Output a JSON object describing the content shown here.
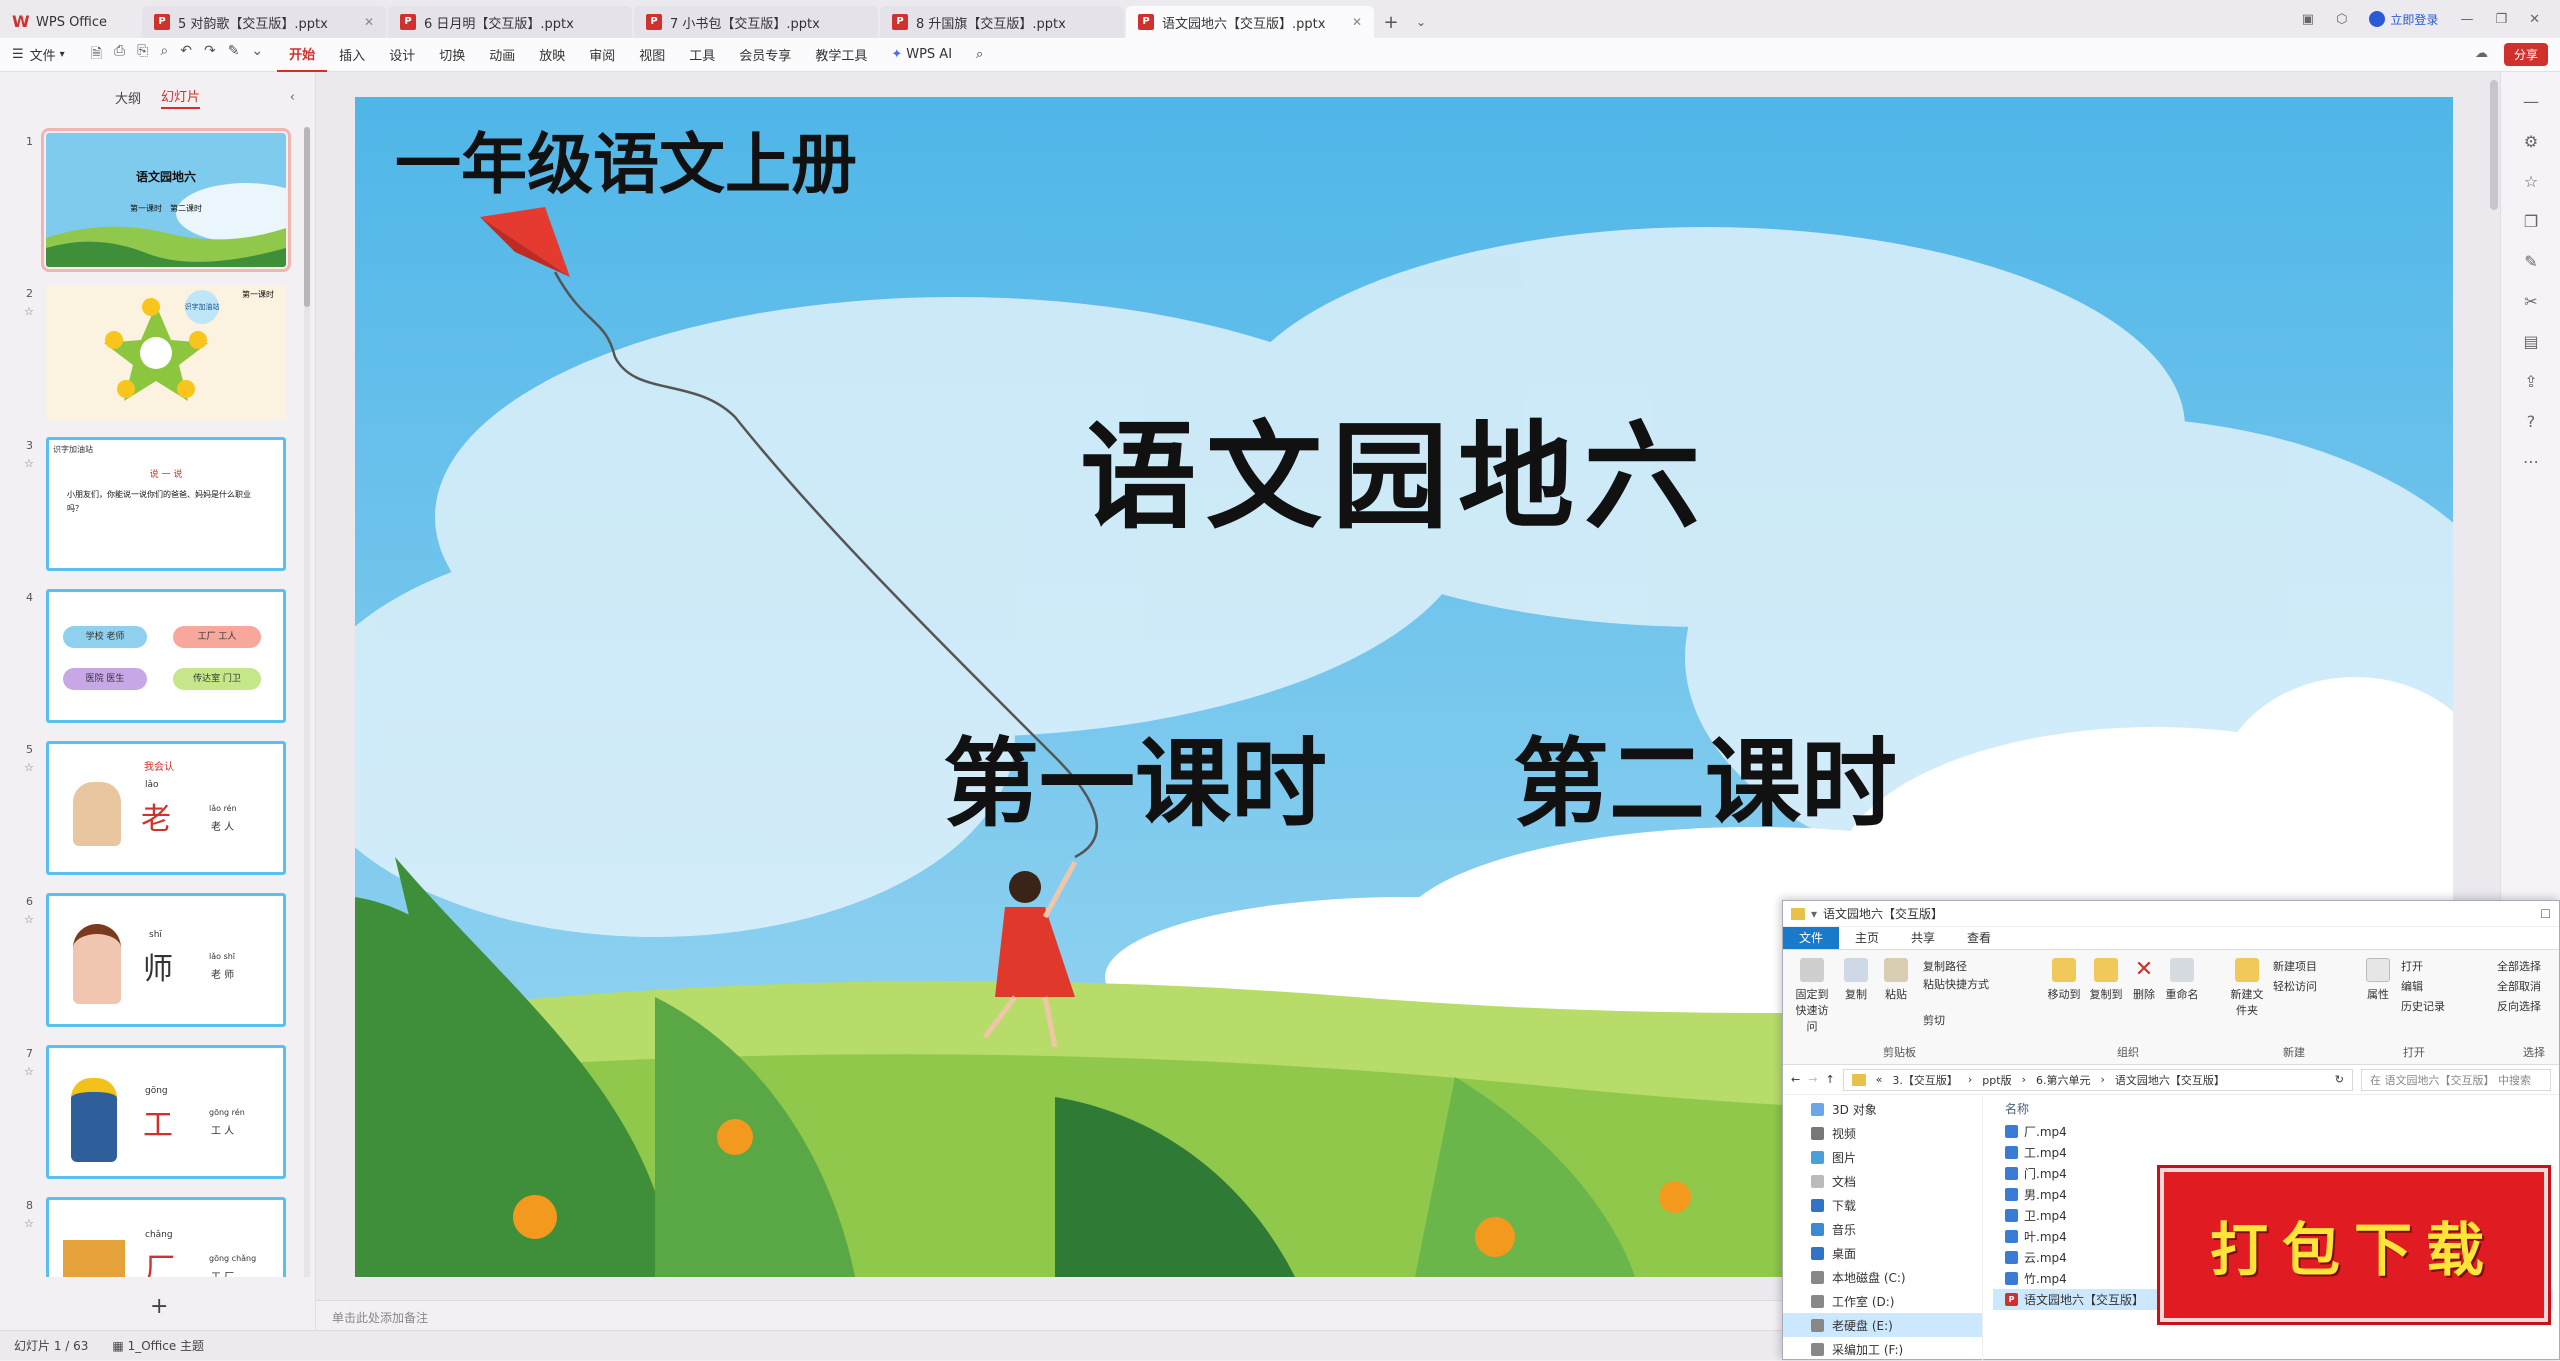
{
  "tabs": {
    "home": "WPS Office",
    "docs": [
      "5 对韵歌【交互版】.pptx",
      "6 日月明【交互版】.pptx",
      "7 小书包【交互版】.pptx",
      "8 升国旗【交互版】.pptx"
    ],
    "active": "语文园地六【交互版】.pptx",
    "login": "立即登录"
  },
  "ribbon": {
    "file": "文件",
    "menus": [
      "开始",
      "插入",
      "设计",
      "切换",
      "动画",
      "放映",
      "审阅",
      "视图",
      "工具",
      "会员专享",
      "教学工具"
    ],
    "ai": "WPS AI",
    "share": "分享"
  },
  "panel": {
    "outline": "大纲",
    "slides": "幻灯片"
  },
  "thumbs": {
    "t1_title": "语文园地六",
    "t1_sub": "第一课时　第二课时",
    "t2_label": "第一课时",
    "t2_badge": "识字加油站",
    "t3_tag": "识字加油站",
    "t3_head": "说 一 说",
    "t3_text": "小朋友们，你能说一说你们的爸爸、妈妈是什么职业吗？",
    "t4_words": [
      "学校 老师",
      "工厂 工人",
      "医院 医生",
      "传达室 门卫"
    ],
    "t5_head": "我会认",
    "slides": [
      {
        "py": "lǎo",
        "char": "老",
        "word_py": "lǎo rén",
        "word": "老 人"
      },
      {
        "py": "shī",
        "char": "师",
        "word_py": "lǎo shī",
        "word": "老 师"
      },
      {
        "py": "gōng",
        "char": "工",
        "word_py": "gōng rén",
        "word": "工 人"
      },
      {
        "py": "chǎng",
        "char": "厂",
        "word_py": "gōng chǎng",
        "word": "工 厂"
      }
    ]
  },
  "slide": {
    "grade": "一年级语文上册",
    "title": "语文园地六",
    "lesson1": "第一课时",
    "lesson2": "第二课时"
  },
  "notes_placeholder": "单击此处添加备注",
  "status": {
    "slide_count": "幻灯片 1 / 63",
    "theme": "1_Office 主题"
  },
  "explorer": {
    "title": "语文园地六【交互版】",
    "tabs": [
      "文件",
      "主页",
      "共享",
      "查看"
    ],
    "ribbon": {
      "pin": "固定到快速访问",
      "copy": "复制",
      "paste": "粘贴",
      "copy_path": "复制路径",
      "paste_shortcut": "粘贴快捷方式",
      "cut": "剪切",
      "clipboard": "剪贴板",
      "move_to": "移动到",
      "copy_to": "复制到",
      "delete": "删除",
      "rename": "重命名",
      "organize": "组织",
      "new_folder": "新建文件夹",
      "new_item": "新建项目",
      "easy_access": "轻松访问",
      "new": "新建",
      "properties": "属性",
      "open": "打开",
      "edit": "编辑",
      "history": "历史记录",
      "open_grp": "打开",
      "select_all": "全部选择",
      "select_none": "全部取消",
      "invert": "反向选择",
      "select": "选择"
    },
    "path": [
      "3.【交互版】",
      "ppt版",
      "6.第六单元",
      "语文园地六【交互版】"
    ],
    "search": "在 语文园地六【交互版】 中搜索",
    "nav": [
      "3D 对象",
      "视频",
      "图片",
      "文档",
      "下载",
      "音乐",
      "桌面",
      "本地磁盘 (C:)",
      "工作室 (D:)",
      "老硬盘 (E:)",
      "采编加工 (F:)"
    ],
    "col_name": "名称",
    "files": [
      "厂.mp4",
      "工.mp4",
      "门.mp4",
      "男.mp4",
      "卫.mp4",
      "叶.mp4",
      "云.mp4",
      "竹.mp4",
      "语文园地六【交互版】"
    ]
  },
  "banner": "打包下载",
  "colors": {
    "accent": "#d0312d",
    "sky": "#4fb6e8",
    "grass": "#8fc84a",
    "banner": "#e11b22"
  }
}
